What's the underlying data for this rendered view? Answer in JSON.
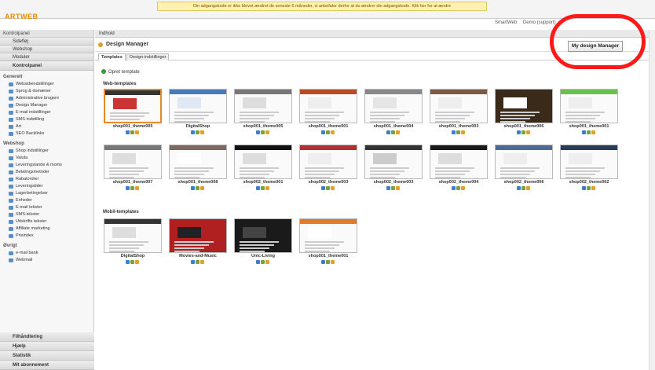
{
  "app": {
    "logo": "ARTWEB",
    "notice": "Din adgangskode er ikke blevet ændret de seneste 6 måneder, vi anbefaler derfor at du ændrer din adgangskode. Klik her for at ændre",
    "top_links": [
      "SmartWeb",
      "Demo (support)"
    ]
  },
  "sidebar": {
    "header": "Kontrolpanel",
    "menus": [
      "Sidefløj",
      "Webshop",
      "Moduler"
    ],
    "control_panel": "Kontrolpanel",
    "sections": [
      {
        "title": "Generelt",
        "items": [
          "Websideindstillinger",
          "Sprog & domæner",
          "Administrative brugere",
          "Design Manager",
          "E-mail indstillinger",
          "SMS indstilling",
          "Art",
          "SEO Backlinks"
        ]
      },
      {
        "title": "Webshop",
        "items": [
          "Shop indstillinger",
          "Valuta",
          "Leveringslande & moms",
          "Betalingsmetoder",
          "Rabatordrer",
          "Leveringstider",
          "Lagerbetingelser",
          "Enheder",
          "E-mail tekster",
          "SMS-tekster",
          "Udskrifts tekster",
          "Affiliate marketing",
          "Prisindex"
        ]
      },
      {
        "title": "Øvrigt",
        "items": [
          "e-mail bank",
          "Webmail"
        ]
      }
    ],
    "bottom_menus": [
      "Filhåndtering",
      "Hjælp",
      "Statistik",
      "Mit abonnement"
    ]
  },
  "main": {
    "breadcrumb": "Indhold",
    "title": "Design Manager",
    "my_design_button": "My design Manager",
    "tabs": [
      "Templates",
      "Design-indstillinger"
    ],
    "new_template": "Opret template",
    "web_label": "Web-templates",
    "mobile_label": "Mobil-templates",
    "web_templates": [
      "shop001_theme005",
      "DigitalShop",
      "shop001_theme005",
      "shop001_theme001",
      "shop001_theme004",
      "shop001_theme003",
      "shop001_theme006",
      "shop001_theme001",
      "shop001_theme007",
      "shop001_theme008",
      "shop002_theme001",
      "shop002_theme003",
      "shop002_theme003",
      "shop002_theme004",
      "shop002_theme006",
      "shop002_theme002"
    ],
    "mobile_templates": [
      "DigitalShop",
      "Movies-and-Music",
      "Unic-Living",
      "shop001_theme001"
    ]
  },
  "chart_colors": {
    "accent": "#e38a2a",
    "annotation": "#ff1a1a"
  }
}
